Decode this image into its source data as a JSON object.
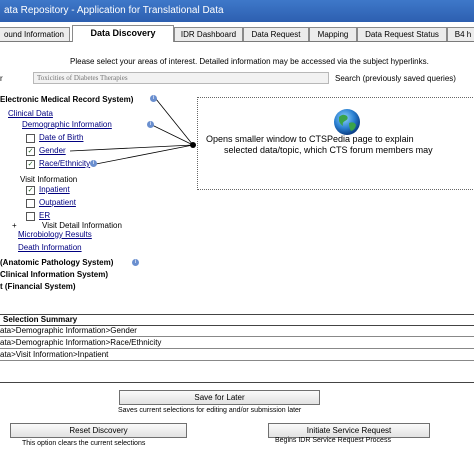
{
  "window": {
    "title": "ata Repository - Application for Translational Data"
  },
  "tabs": [
    {
      "label": "ound Information"
    },
    {
      "label": "Data Discovery"
    },
    {
      "label": "IDR Dashboard"
    },
    {
      "label": "Data Request"
    },
    {
      "label": "Mapping"
    },
    {
      "label": "Data Request Status"
    },
    {
      "label": "B4 h"
    }
  ],
  "instructions": "Please select your areas of interest.  Detailed information may be accessed via the subject hyperlinks.",
  "search": {
    "label": "r",
    "placeholder": "Toxicities of Diabetes Therapies",
    "link": "Search (previously saved queries)"
  },
  "tree": {
    "emr": "Electronic Medical Record System)",
    "clinical_data": "Clinical Data",
    "demographic": "Demographic Information",
    "dob": "Date of Birth",
    "gender": "Gender",
    "race": "Race/Ethnicity",
    "visit": "Visit Information",
    "inpatient": "Inpatient",
    "outpatient": "Outpatient",
    "er": "ER",
    "visit_detail": "Visit Detail Information",
    "micro": "Microbiology Results",
    "death": "Death Information",
    "anatomic": "(Anatomic Pathology System)",
    "clinical_info": "Clinical Information System)",
    "financial": "t (Financial System)",
    "check_mark": "✓",
    "info_mark": "i",
    "expand_mark": "+"
  },
  "callout": {
    "line1": "Opens smaller window to CTSPedia page to explain",
    "line2": "selected data/topic, which CTS forum members may"
  },
  "summary": {
    "header": "Selection Summary",
    "rows": [
      "ata>Demographic Information>Gender",
      "ata>Demographic Information>Race/Ethnicity",
      "ata>Visit Information>Inpatient"
    ]
  },
  "actions": {
    "save": "Save for Later",
    "save_desc": "Saves current selections for editing and/or submission later",
    "reset": "Reset Discovery",
    "reset_desc": "This option clears the current selections",
    "initiate": "Initiate Service Request",
    "initiate_desc": "Begins IDR Service Request Process"
  },
  "colors": {
    "titlebar": "#2d5fb0",
    "link": "#000080"
  },
  "icons": [
    "globe-icon",
    "info-icon",
    "checkbox-icon",
    "expand-icon"
  ]
}
